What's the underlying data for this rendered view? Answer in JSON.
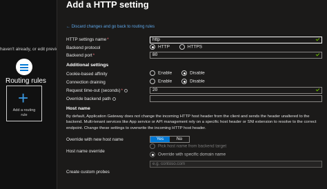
{
  "backdrop": {
    "hint_text": "haven't already, or edit previous c",
    "routing_rules_title": "Routing rules",
    "add_card_label_line1": "Add a routing",
    "add_card_label_line2": "rule"
  },
  "panel": {
    "title": "Add a HTTP setting",
    "back_link": "← Discard changes and go back to routing rules",
    "settings_name_label": "HTTP settings name",
    "settings_name_value": "http",
    "backend_protocol_label": "Backend protocol",
    "protocol_options": [
      "HTTP",
      "HTTPS"
    ],
    "protocol_selected": "HTTP",
    "backend_port_label": "Backend port",
    "backend_port_value": "80",
    "additional_settings_heading": "Additional settings",
    "cookie_affinity_label": "Cookie-based affinity",
    "connection_draining_label": "Connection draining",
    "enable_label": "Enable",
    "disable_label": "Disable",
    "timeout_label": "Request time-out (seconds)",
    "timeout_value": "20",
    "override_path_label": "Override backend path",
    "override_path_value": "",
    "host_name_heading": "Host name",
    "host_name_description": "By default, Application Gateway does not change the incoming HTTP host header from the client and sends the header unaltered to the backend. Multi-tenant services like App service or API management rely on a specific host header or SNI extension to resolve to the correct endpoint. Change these settings to overwrite the incoming HTTP host header.",
    "override_new_host_label": "Override with new host name",
    "toggle_yes": "Yes",
    "toggle_no": "No",
    "host_override_label": "Host name override",
    "pick_from_backend": "Pick host name from backend target",
    "override_specific": "Override with specific domain name",
    "domain_placeholder": "e.g. contoso.com",
    "custom_probes_label": "Create custom probes"
  }
}
